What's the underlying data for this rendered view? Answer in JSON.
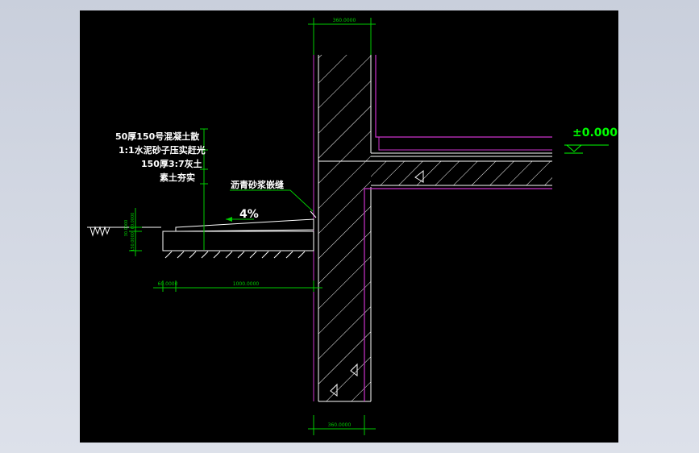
{
  "drawing": {
    "dims": {
      "top_wall_width": "360.0000",
      "bottom_wall_width": "360.0000",
      "left_offset": "60.0000",
      "apron_width": "1000.0000",
      "v_dim_1": "60.0000",
      "v_dim_2": "30.0000",
      "v_dim_3": "150.0000"
    },
    "elevation": "±0.000",
    "slope": "4%",
    "labels": {
      "line1": "50厚150号混凝土散",
      "line2": "1:1水泥砂子压实赶光",
      "line3": "150厚3:7灰土",
      "line4": "素土夯实",
      "joint": "沥青砂浆嵌缝"
    }
  },
  "colors": {
    "background": "#000000",
    "line": "#ffffff",
    "label": "#ffffff",
    "leader": "#00cc00",
    "dimension": "#00cc00",
    "finish": "#cc33cc",
    "elevation": "#00ff00",
    "window_frame": "#d3d8e4"
  }
}
